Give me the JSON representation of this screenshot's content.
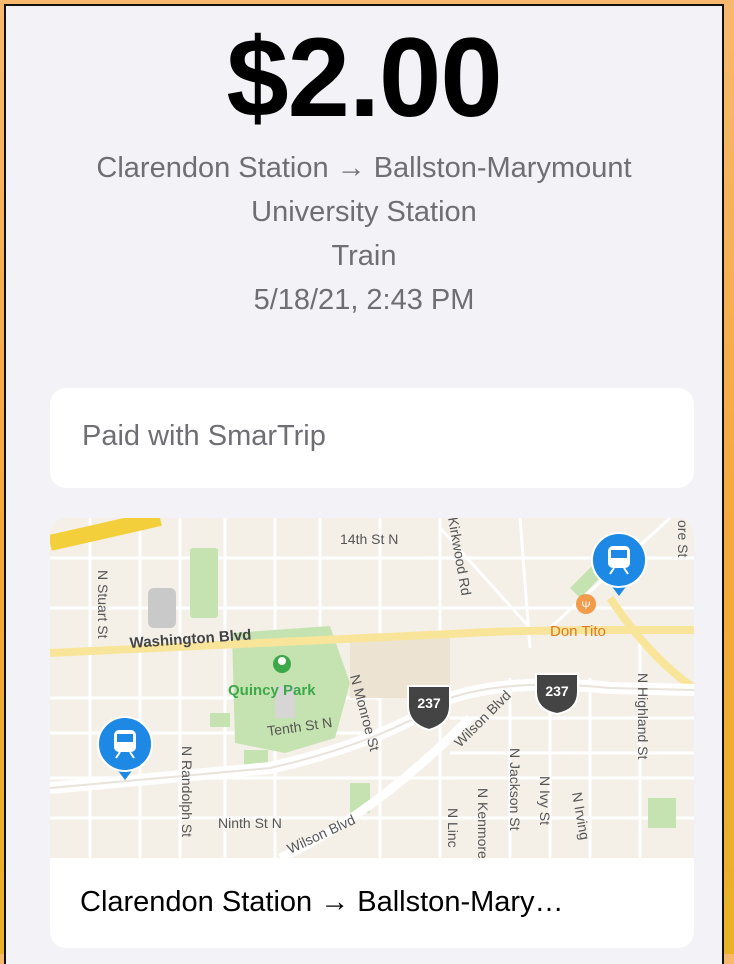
{
  "receipt": {
    "amount": "$2.00",
    "route_line1": "Clarendon Station → Ballston-Marymount",
    "route_line2": "University Station",
    "mode": "Train",
    "datetime": "5/18/21, 2:43 PM"
  },
  "payment": {
    "label": "Paid with SmarTrip"
  },
  "map": {
    "caption": "Clarendon Station → Ballston-Mary…",
    "streets": {
      "washington_blvd": "Washington Blvd",
      "fourteenth": "14th St N",
      "stuart": "N Stuart St",
      "randolph": "N Randolph St",
      "quincy_park": "Quincy Park",
      "tenth": "Tenth St N",
      "monroe": "N Monroe St",
      "ninth": "Ninth St N",
      "wilson1": "Wilson Blvd",
      "wilson2": "Wilson Blvd",
      "kirkwood": "Kirkwood Rd",
      "jackson": "N Jackson St",
      "kenmore": "N Kenmore",
      "lincoln": "N Linc",
      "ivy": "N Ivy St",
      "irving": "N Irving",
      "highland": "N Highland St",
      "glebe": "ore St",
      "don_tito": "Don Tito",
      "route_shield_1": "237",
      "route_shield_2": "237"
    },
    "colors": {
      "transit_pin": "#1e88e5",
      "park": "#c5e3b0",
      "main_road": "#f9e59a",
      "restaurant": "#f29b4a"
    }
  }
}
